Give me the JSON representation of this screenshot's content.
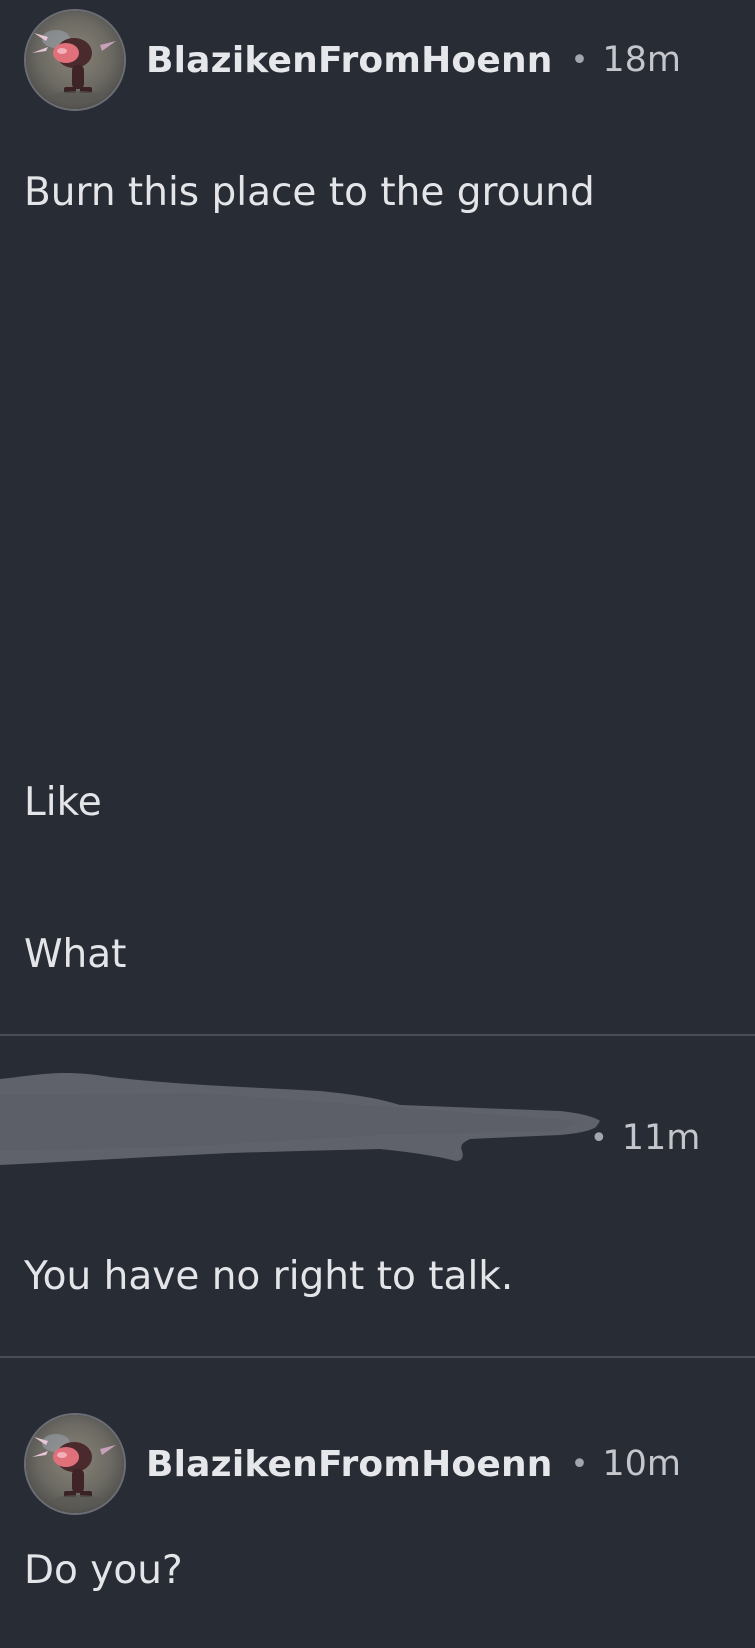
{
  "thread": {
    "posts": [
      {
        "username": "BlazikenFromHoenn",
        "separator": "•",
        "time": "18m",
        "lines": [
          "Burn this place to the ground",
          "Like",
          "What"
        ]
      },
      {
        "username_redacted": true,
        "separator": "•",
        "time": "11m",
        "lines": [
          "You have no right to talk."
        ]
      },
      {
        "username": "BlazikenFromHoenn",
        "separator": "•",
        "time": "10m",
        "lines": [
          "Do you?"
        ]
      }
    ]
  },
  "colors": {
    "background": "#282c34",
    "divider": "#4a4e57",
    "redaction": "#5f626a",
    "text": "#e4e5e8",
    "muted": "#c4c6cb"
  },
  "icons": {
    "avatar": "blaziken-avatar-image",
    "redaction": "redaction-scribble"
  }
}
